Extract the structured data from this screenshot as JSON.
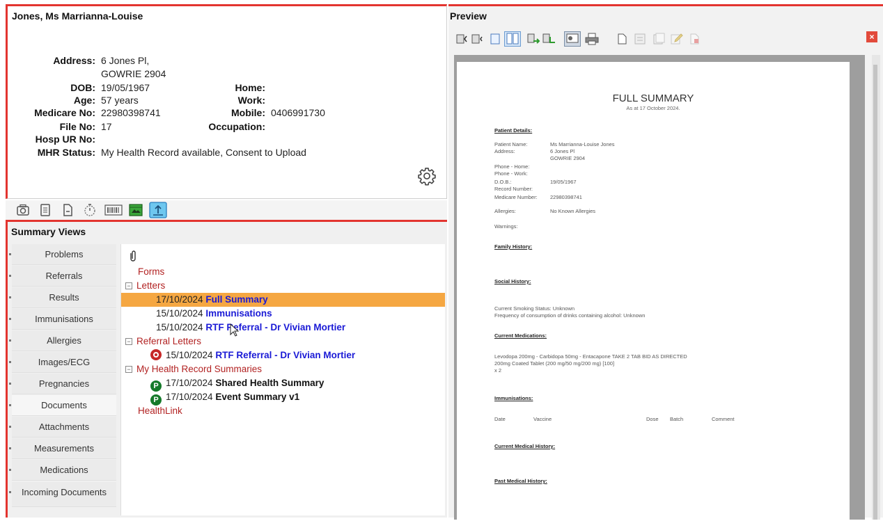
{
  "patient": {
    "name": "Jones, Ms Marrianna-Louise",
    "address_label": "Address:",
    "address_line1": "6 Jones Pl,",
    "address_line2": "GOWRIE  2904",
    "dob_label": "DOB:",
    "dob": "19/05/1967",
    "age_label": "Age:",
    "age": "57 years",
    "medicare_label": "Medicare No:",
    "medicare": "22980398741",
    "file_label": "File No:",
    "file": "17",
    "hosp_label": "Hosp UR No:",
    "hosp": "",
    "mhr_label": "MHR Status:",
    "mhr": "My Health Record available, Consent to Upload",
    "home_label": "Home:",
    "home": "",
    "work_label": "Work:",
    "work": "",
    "mobile_label": "Mobile:",
    "mobile": "0406991730",
    "occupation_label": "Occupation:",
    "occupation": ""
  },
  "summary": {
    "title": "Summary Views",
    "tabs": [
      "Problems",
      "Referrals",
      "Results",
      "Immunisations",
      "Allergies",
      "Images/ECG",
      "Pregnancies",
      "Documents",
      "Attachments",
      "Measurements",
      "Medications",
      "Incoming Documents"
    ],
    "active_tab": "Documents",
    "tree": {
      "forms": "Forms",
      "letters": "Letters",
      "letter_items": [
        {
          "date": "17/10/2024",
          "title": "Full Summary"
        },
        {
          "date": "15/10/2024",
          "title": "Immunisations"
        },
        {
          "date": "15/10/2024",
          "title": "RTF Referral - Dr Vivian Mortier"
        }
      ],
      "referral_letters": "Referral Letters",
      "referral_items": [
        {
          "date": "15/10/2024",
          "title": "RTF Referral - Dr Vivian Mortier"
        }
      ],
      "mhr_summaries": "My Health Record Summaries",
      "mhr_badge": "P",
      "mhr_items": [
        {
          "date": "17/10/2024",
          "title": "Shared Health Summary"
        },
        {
          "date": "17/10/2024",
          "title": "Event Summary v1"
        }
      ],
      "healthlink": "HealthLink"
    }
  },
  "preview": {
    "title": "Preview",
    "close": "×",
    "doc": {
      "title": "FULL SUMMARY",
      "subtitle": "As at 17 October 2024.",
      "patient_details_h": "Patient Details:",
      "patient_name_label": "Patient Name:",
      "patient_name": "Ms Marrianna-Louise Jones",
      "address_label": "Address:",
      "address1": "6 Jones Pl",
      "address2": "GOWRIE  2904",
      "phone_home": "Phone - Home:",
      "phone_work": "Phone - Work:",
      "dob_label": "D.O.B.:",
      "dob": "19/05/1967",
      "record_number": "Record Number:",
      "medicare_label": "Medicare Number:",
      "medicare": "22980398741",
      "allergies_label": "Allergies:",
      "allergies": "No Known Allergies",
      "warnings_label": "Warnings:",
      "family_history_h": "Family History:",
      "social_history_h": "Social History:",
      "smoking": "Current Smoking Status: Unknown",
      "alcohol": "Frequency of consumption of drinks containing alcohol: Unknown",
      "current_meds_h": "Current Medications:",
      "med_line1": "Levodopa 200mg - Carbidopa 50mg - Entacapone     TAKE 2 TAB BID AS DIRECTED",
      "med_line2": "200mg Coated Tablet (200 mg/50 mg/200 mg) [100]",
      "med_line3": "x 2",
      "immunisations_h": "Immunisations:",
      "imm_cols": [
        "Date",
        "Vaccine",
        "Dose",
        "Batch",
        "Comment"
      ],
      "current_medical_h": "Current Medical History:",
      "past_medical_h": "Past Medical History:"
    }
  }
}
